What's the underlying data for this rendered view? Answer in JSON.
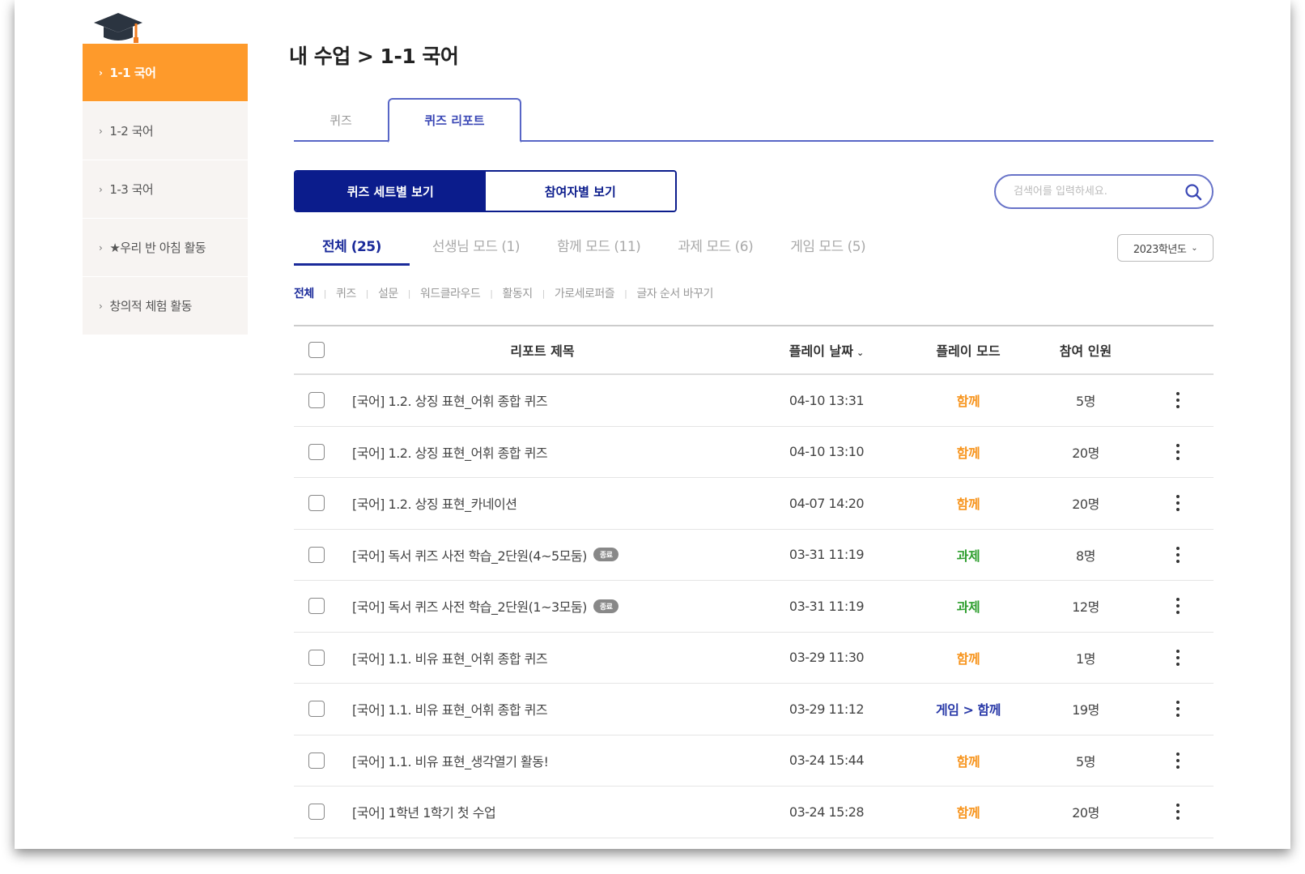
{
  "sidebar": {
    "items": [
      {
        "label": "1-1 국어"
      },
      {
        "label": "1-2 국어"
      },
      {
        "label": "1-3 국어"
      },
      {
        "label": "★우리 반 아침 활동"
      },
      {
        "label": "창의적 체험 활동"
      }
    ]
  },
  "breadcrumb": "내 수업 > 1-1 국어",
  "tabs": [
    "퀴즈",
    "퀴즈 리포트"
  ],
  "view_toggle": {
    "by_set": "퀴즈 세트별 보기",
    "by_participant": "참여자별 보기"
  },
  "search": {
    "placeholder": "검색어를 입력하세요."
  },
  "mode_tabs": [
    "전체 (25)",
    "선생님 모드 (1)",
    "함께 모드 (11)",
    "과제 모드 (6)",
    "게임 모드 (5)"
  ],
  "year_select": {
    "value": "2023학년도"
  },
  "type_filter": [
    "전체",
    "퀴즈",
    "설문",
    "워드클라우드",
    "활동지",
    "가로세로퍼즐",
    "글자 순서 바꾸기"
  ],
  "table": {
    "headers": {
      "title": "리포트 제목",
      "date": "플레이 날짜",
      "mode": "플레이 모드",
      "count": "참여 인원"
    },
    "rows": [
      {
        "title": "[국어] 1.2. 상징 표현_어휘 종합 퀴즈",
        "badge": "",
        "date": "04-10 13:31",
        "mode": "함께",
        "mode_color": "#f7941d",
        "count": "5명"
      },
      {
        "title": "[국어] 1.2. 상징 표현_어휘 종합 퀴즈",
        "badge": "",
        "date": "04-10 13:10",
        "mode": "함께",
        "mode_color": "#f7941d",
        "count": "20명"
      },
      {
        "title": "[국어] 1.2. 상징 표현_카네이션",
        "badge": "",
        "date": "04-07 14:20",
        "mode": "함께",
        "mode_color": "#f7941d",
        "count": "20명"
      },
      {
        "title": "[국어] 독서 퀴즈 사전 학습_2단원(4~5모둠)",
        "badge": "종료",
        "date": "03-31 11:19",
        "mode": "과제",
        "mode_color": "#2e9e2e",
        "count": "8명"
      },
      {
        "title": "[국어] 독서 퀴즈 사전 학습_2단원(1~3모둠)",
        "badge": "종료",
        "date": "03-31 11:19",
        "mode": "과제",
        "mode_color": "#2e9e2e",
        "count": "12명"
      },
      {
        "title": "[국어] 1.1. 비유 표현_어휘 종합 퀴즈",
        "badge": "",
        "date": "03-29 11:30",
        "mode": "함께",
        "mode_color": "#f7941d",
        "count": "1명"
      },
      {
        "title": "[국어] 1.1. 비유 표현_어휘 종합 퀴즈",
        "badge": "",
        "date": "03-29 11:12",
        "mode": "게임 > 함께",
        "mode_color": "#2a3aa8",
        "count": "19명"
      },
      {
        "title": "[국어] 1.1. 비유 표현_생각열기 활동!",
        "badge": "",
        "date": "03-24 15:44",
        "mode": "함께",
        "mode_color": "#f7941d",
        "count": "5명"
      },
      {
        "title": "[국어] 1학년 1학기 첫 수업",
        "badge": "",
        "date": "03-24 15:28",
        "mode": "함께",
        "mode_color": "#f7941d",
        "count": "20명"
      }
    ]
  },
  "colors": {
    "accent": "#fe9a2b",
    "navy": "#0b1c8c",
    "tab_border": "#5866c6"
  }
}
